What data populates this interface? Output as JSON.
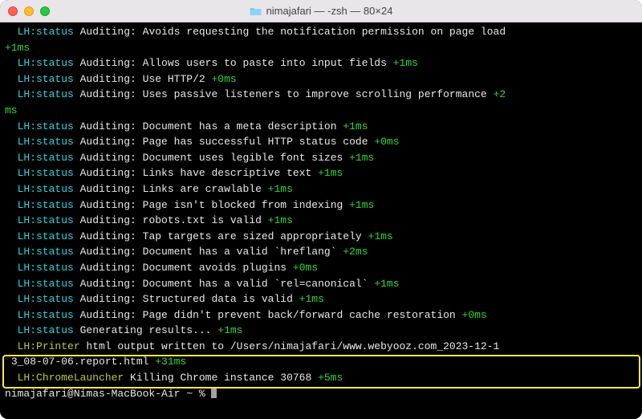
{
  "window": {
    "title": "nimajafari — -zsh — 80×24"
  },
  "labels": {
    "status": "LH:status",
    "printer": "LH:Printer",
    "chrome": "LH:ChromeLauncher",
    "auditing": "Auditing:"
  },
  "lines": [
    {
      "msg": "Avoids requesting the notification permission on page load",
      "time": "+1ms",
      "wrapTimeFirst": true
    },
    {
      "msg": "Allows users to paste into input fields",
      "time": "+1ms"
    },
    {
      "msg": "Use HTTP/2",
      "time": "+0ms"
    },
    {
      "msg": "Uses passive listeners to improve scrolling performance",
      "time": "+2ms",
      "wrapTimeLast": true
    },
    {
      "msg": "Document has a meta description",
      "time": "+1ms"
    },
    {
      "msg": "Page has successful HTTP status code",
      "time": "+0ms"
    },
    {
      "msg": "Document uses legible font sizes",
      "time": "+1ms"
    },
    {
      "msg": "Links have descriptive text",
      "time": "+1ms"
    },
    {
      "msg": "Links are crawlable",
      "time": "+1ms"
    },
    {
      "msg": "Page isn't blocked from indexing",
      "time": "+1ms"
    },
    {
      "msg": "robots.txt is valid",
      "time": "+1ms"
    },
    {
      "msg": "Tap targets are sized appropriately",
      "time": "+1ms"
    },
    {
      "msg": "Document has a valid `hreflang`",
      "time": "+2ms"
    },
    {
      "msg": "Document avoids plugins",
      "time": "+0ms"
    },
    {
      "msg": "Document has a valid `rel=canonical`",
      "time": "+1ms"
    },
    {
      "msg": "Structured data is valid",
      "time": "+1ms"
    },
    {
      "msg": "Page didn't prevent back/forward cache restoration",
      "time": "+0ms"
    }
  ],
  "generating": {
    "msg": "Generating results...",
    "time": "+1ms"
  },
  "printer": {
    "msg": "html output written to /Users/nimajafari/www.webyooz.com_2023-12-13_08-07-06.report.html",
    "time": "+31ms"
  },
  "chrome": {
    "msg": "Killing Chrome instance 30768",
    "time": "+5ms"
  },
  "prompt": {
    "user": "nimajafari@Nimas-MacBook-Air",
    "path": "~",
    "symbol": "%"
  }
}
